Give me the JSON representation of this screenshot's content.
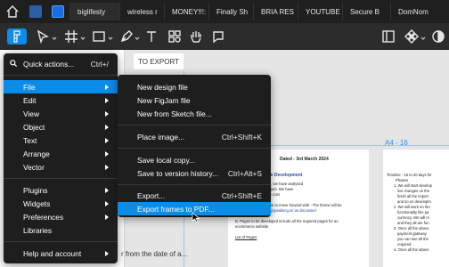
{
  "tabs": [
    {
      "label": "biglifesty"
    },
    {
      "label": "wireless r"
    },
    {
      "label": "MONEY!!!:"
    },
    {
      "label": "Finally Sh"
    },
    {
      "label": "BRIA RES"
    },
    {
      "label": "YOUTUBE"
    },
    {
      "label": "Secure B"
    },
    {
      "label": "DomNom"
    }
  ],
  "canvas": {
    "to_export_label": "TO EXPORT",
    "frame_label": "A4 - 16",
    "dated": "Dated - 3rd March 2024",
    "doc_heading": "ities for Website Development",
    "doc_lines": [
      "ub topic requirements, we have analysed",
      "above mentioned subject. We have",
      "ities & their respective cost",
      "",
      "A. Selecting one theme to move forward with - The theme will be",
      "similar to https://www.joywalking.in/ as discussed",
      "",
      "B. Pages to be developed include all the required pages for an",
      "ecommerce website",
      "",
      "List of Pages"
    ],
    "right_lines": [
      "Timeline - 15 to 20 days for",
      "Phases",
      "1. We will start develop",
      "live changes on the",
      "finish all the import",
      "and so on developm",
      "2. We will work on the",
      "functionality like pa",
      "currency. We will m",
      "and they all are fun",
      "3. Once all the above",
      "payment gateway",
      "you can see all the",
      "required",
      "4. Once all the above"
    ],
    "bottom_text": "r from the date of a..."
  },
  "main_menu": {
    "search_label": "Quick actions...",
    "search_shortcut": "Ctrl+/",
    "items": [
      {
        "label": "File"
      },
      {
        "label": "Edit"
      },
      {
        "label": "View"
      },
      {
        "label": "Object"
      },
      {
        "label": "Text"
      },
      {
        "label": "Arrange"
      },
      {
        "label": "Vector"
      },
      {
        "label": "Plugins"
      },
      {
        "label": "Widgets"
      },
      {
        "label": "Preferences"
      },
      {
        "label": "Libraries"
      },
      {
        "label": "Help and account"
      }
    ]
  },
  "file_menu": {
    "items": [
      {
        "label": "New design file",
        "shortcut": ""
      },
      {
        "label": "New FigJam file",
        "shortcut": ""
      },
      {
        "label": "New from Sketch file...",
        "shortcut": ""
      },
      {
        "label": "Place image...",
        "shortcut": "Ctrl+Shift+K"
      },
      {
        "label": "Save local copy...",
        "shortcut": ""
      },
      {
        "label": "Save to version history...",
        "shortcut": "Ctrl+Alt+S"
      },
      {
        "label": "Export...",
        "shortcut": "Ctrl+Shift+E"
      },
      {
        "label": "Export frames to PDF...",
        "shortcut": ""
      }
    ]
  },
  "colors": {
    "accent": "#0c8ce9",
    "menu_bg": "#1e1e1e",
    "toolbar_bg": "#2c2c2c",
    "frame_label": "#2f8cf0"
  }
}
